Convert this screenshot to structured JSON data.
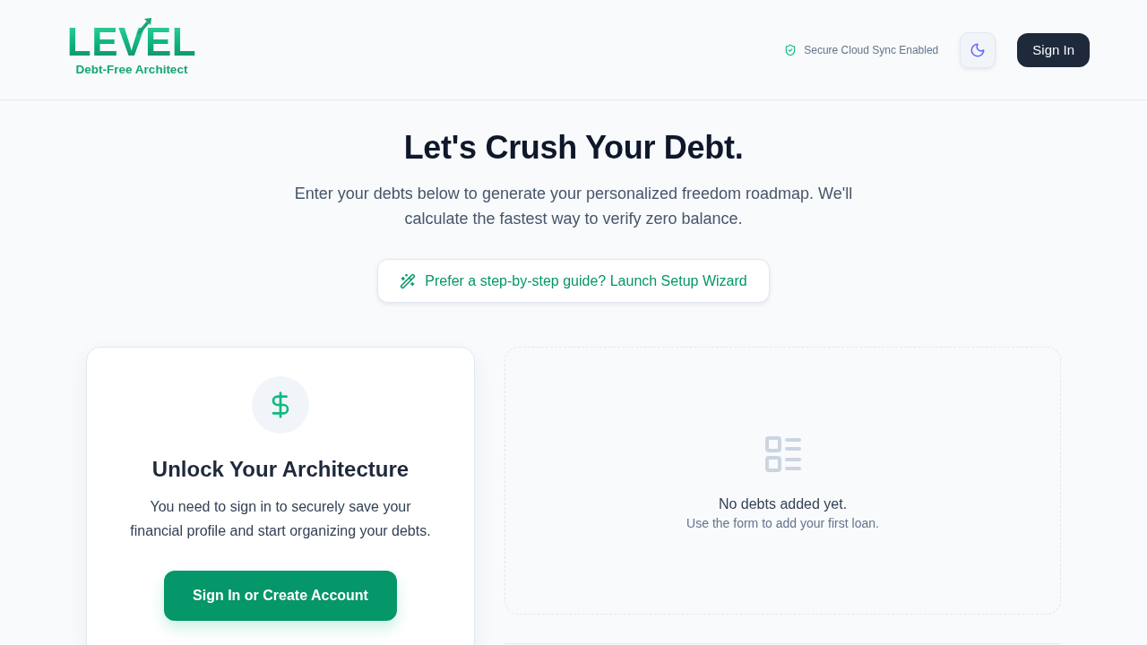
{
  "header": {
    "logo": {
      "wordmark": "LEVEL",
      "tagline": "Debt-Free Architect"
    },
    "sync_status": "Secure Cloud Sync Enabled",
    "sign_in_button": "Sign In"
  },
  "hero": {
    "title": "Let's Crush Your Debt.",
    "subtitle": "Enter your debts below to generate your personalized freedom roadmap. We'll calculate the fastest way to verify zero balance.",
    "wizard_button": "Prefer a step-by-step guide? Launch Setup Wizard"
  },
  "sign_in_card": {
    "title": "Unlock Your Architecture",
    "text": "You need to sign in to securely save your financial profile and start organizing your debts.",
    "button": "Sign In or Create Account"
  },
  "debts_list": {
    "empty_title": "No debts added yet.",
    "empty_hint": "Use the form to add your first loan."
  }
}
